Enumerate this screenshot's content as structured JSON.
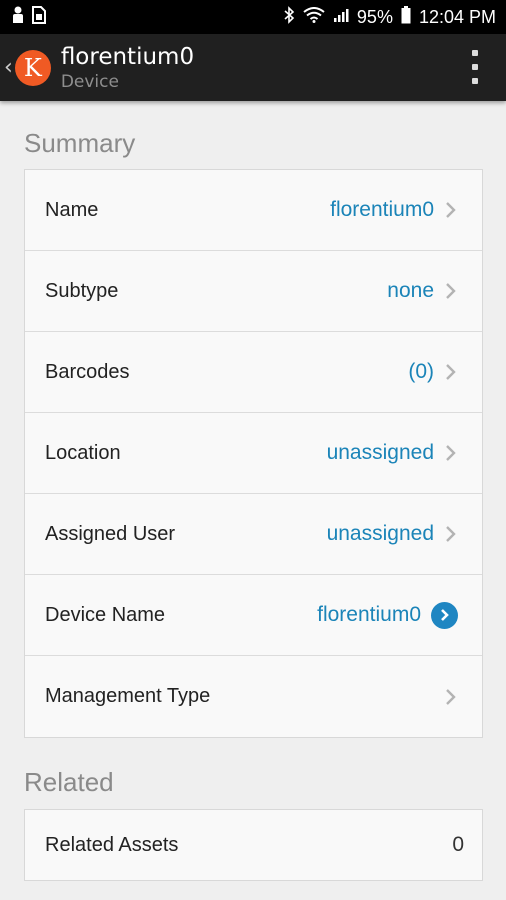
{
  "status_bar": {
    "battery_percent": "95%",
    "time": "12:04 PM",
    "left_icons": [
      "person-icon",
      "sim-icon"
    ],
    "right_icons": [
      "bluetooth-icon",
      "wifi-icon",
      "signal-icon",
      "battery-icon"
    ]
  },
  "app_bar": {
    "title": "florentium0",
    "subtitle": "Device",
    "logo_letter": "K",
    "accent_color": "#f05a24"
  },
  "summary": {
    "heading": "Summary",
    "rows": [
      {
        "label": "Name",
        "value": "florentium0"
      },
      {
        "label": "Subtype",
        "value": "none"
      },
      {
        "label": "Barcodes",
        "value": "(0)"
      },
      {
        "label": "Location",
        "value": "unassigned"
      },
      {
        "label": "Assigned User",
        "value": "unassigned"
      },
      {
        "label": "Device Name",
        "value": "florentium0"
      },
      {
        "label": "Management Type",
        "value": ""
      }
    ]
  },
  "related": {
    "heading": "Related",
    "rows": [
      {
        "label": "Related Assets",
        "value": "0"
      }
    ]
  },
  "colors": {
    "link": "#1b84b8",
    "appbar": "#202020",
    "background": "#efefef"
  }
}
